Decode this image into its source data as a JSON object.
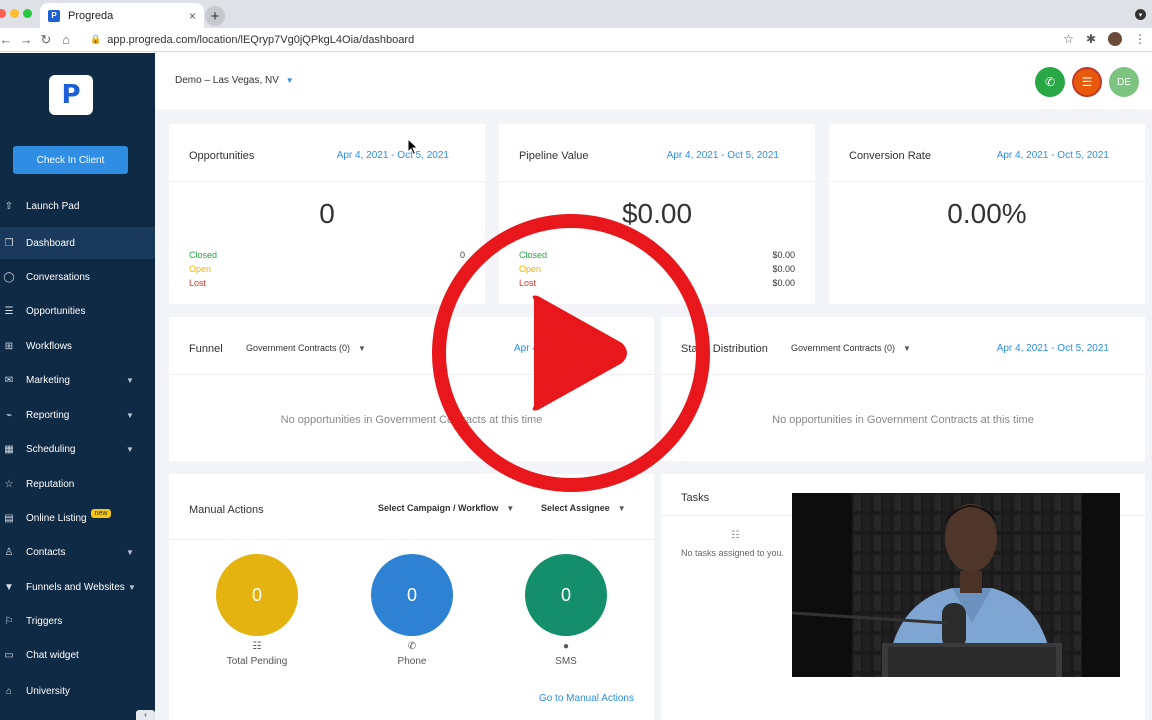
{
  "browser": {
    "tab_title": "Progreda",
    "tab_favicon": "P",
    "tab_close": "×",
    "new_tab": "+",
    "url": "app.progreda.com/location/lEQryp7Vg0jQPkgL4Oia/dashboard"
  },
  "sidebar": {
    "logo_letter": "P",
    "check_in_label": "Check In Client",
    "items": [
      {
        "label": "Launch Pad",
        "icon": "rocket-icon"
      },
      {
        "label": "Dashboard",
        "icon": "dashboard-icon"
      },
      {
        "label": "Conversations",
        "icon": "chat-icon"
      },
      {
        "label": "Opportunities",
        "icon": "layers-icon"
      },
      {
        "label": "Workflows",
        "icon": "workflow-icon"
      },
      {
        "label": "Marketing",
        "icon": "mail-icon"
      },
      {
        "label": "Reporting",
        "icon": "chart-icon"
      },
      {
        "label": "Scheduling",
        "icon": "calendar-icon"
      },
      {
        "label": "Reputation",
        "icon": "star-icon"
      },
      {
        "label": "Online Listing",
        "icon": "list-icon",
        "badge": "new"
      },
      {
        "label": "Contacts",
        "icon": "user-icon"
      },
      {
        "label": "Funnels and Websites",
        "icon": "funnel-icon"
      },
      {
        "label": "Triggers",
        "icon": "trigger-icon"
      },
      {
        "label": "Chat widget",
        "icon": "chat-widget-icon"
      },
      {
        "label": "University",
        "icon": "graduation-icon"
      }
    ]
  },
  "topbar": {
    "location": "Demo – Las Vegas, NV",
    "avatar_initials": "DE",
    "colors": {
      "phone": "#28a745",
      "notify": "#e8590c",
      "avatar": "#7cc47f"
    }
  },
  "cards": {
    "opportunities": {
      "title": "Opportunities",
      "date": "Apr 4, 2021 - Oct 5, 2021",
      "value": "0",
      "rows": [
        {
          "label": "Closed",
          "value": "0"
        },
        {
          "label": "Open",
          "value": ""
        },
        {
          "label": "Lost",
          "value": ""
        }
      ]
    },
    "pipeline": {
      "title": "Pipeline Value",
      "date": "Apr 4, 2021 - Oct 5, 2021",
      "value": "$0.00",
      "rows": [
        {
          "label": "Closed",
          "value": "$0.00"
        },
        {
          "label": "Open",
          "value": "$0.00"
        },
        {
          "label": "Lost",
          "value": "$0.00"
        }
      ]
    },
    "conversion": {
      "title": "Conversion Rate",
      "date": "Apr 4, 2021 - Oct 5, 2021",
      "value": "0.00%"
    },
    "funnel": {
      "title": "Funnel",
      "dropdown": "Government Contracts (0)",
      "date": "Apr 4",
      "empty": "No opportunities in Government Contracts at this time"
    },
    "stage": {
      "title": "Stage Distribution",
      "dropdown": "Government Contracts (0)",
      "date": "Apr 4, 2021 - Oct 5, 2021",
      "empty": "No opportunities in Government Contracts at this time"
    },
    "manual": {
      "title": "Manual Actions",
      "campaign_dropdown": "Select Campaign / Workflow",
      "assignee_dropdown": "Select Assignee",
      "items": [
        {
          "value": "0",
          "label": "Total Pending",
          "color": "#e5b30f"
        },
        {
          "value": "0",
          "label": "Phone",
          "color": "#2d82d3"
        },
        {
          "value": "0",
          "label": "SMS",
          "color": "#13906b"
        }
      ],
      "link": "Go to Manual Actions"
    },
    "tasks": {
      "title": "Tasks",
      "empty": "No tasks assigned to you."
    }
  },
  "colors": {
    "sidebar_bg": "#0f2a44",
    "accent": "#2f8de4",
    "closed": "#28a745",
    "open": "#f0b400",
    "lost": "#d9342b",
    "play": "#e8171c"
  }
}
